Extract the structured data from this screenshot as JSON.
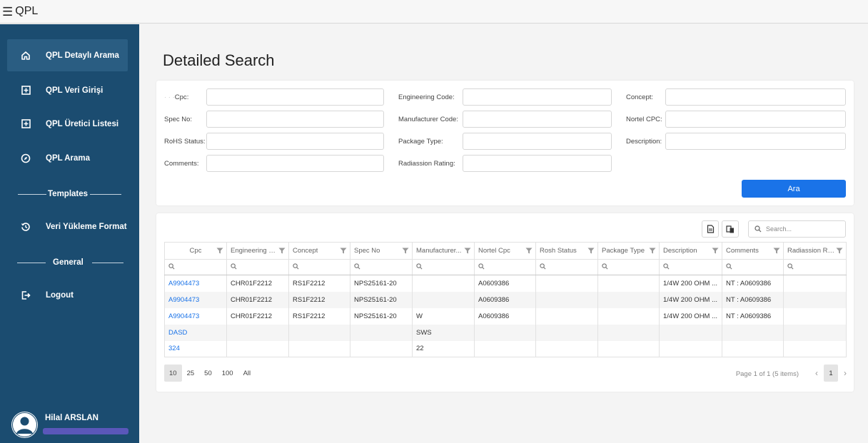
{
  "app": {
    "title": "QPL"
  },
  "sidebar": {
    "items": [
      {
        "label": "QPL Detaylı Arama",
        "icon": "home-icon"
      },
      {
        "label": "QPL Veri Girişi",
        "icon": "plus-square-icon"
      },
      {
        "label": "QPL Üretici Listesi",
        "icon": "plus-square-icon"
      },
      {
        "label": "QPL Arama",
        "icon": "compass-icon"
      }
    ],
    "section_templates": "Templates",
    "templates_item": {
      "label": "Veri Yükleme Format",
      "icon": "history-icon"
    },
    "section_general": "General",
    "logout": {
      "label": "Logout",
      "icon": "logout-icon"
    },
    "user": {
      "name": "Hilal ARSLAN"
    }
  },
  "page": {
    "title": "Detailed Search"
  },
  "form": {
    "fields": [
      {
        "label": "Cpc",
        "value": ""
      },
      {
        "label": "Spec No:",
        "value": ""
      },
      {
        "label": "RoHS Status:",
        "value": ""
      },
      {
        "label": "Comments:",
        "value": ""
      },
      {
        "label": "Engineering Code:",
        "value": ""
      },
      {
        "label": "Manufacturer Code:",
        "value": ""
      },
      {
        "label": "Package Type:",
        "value": ""
      },
      {
        "label": "Radiassion Rating:",
        "value": ""
      },
      {
        "label": "Concept:",
        "value": ""
      },
      {
        "label": "Nortel CPC:",
        "value": ""
      },
      {
        "label": "Description:",
        "value": ""
      }
    ],
    "search_button": "Ara"
  },
  "grid": {
    "search_placeholder": "Search...",
    "columns": [
      "Cpc",
      "Engineering Code",
      "Concept",
      "Spec No",
      "Manufacturer Code",
      "Nortel Cpc",
      "Rosh Status",
      "Package Type",
      "Description",
      "Comments",
      "Radiassion Rating"
    ],
    "column_display": [
      "Cpc",
      "Engineering C...",
      "Concept",
      "Spec No",
      "Manufacturer...",
      "Nortel Cpc",
      "Rosh Status",
      "Package Type",
      "Description",
      "Comments",
      "Radiassion Ra..."
    ],
    "rows": [
      [
        "A9904473",
        "CHR01F2212",
        "RS1F2212",
        "NPS25161-20",
        "",
        "A0609386",
        "",
        "",
        "1/4W 200 OHM ...",
        "NT : A0609386",
        ""
      ],
      [
        "A9904473",
        "CHR01F2212",
        "RS1F2212",
        "NPS25161-20",
        "",
        "A0609386",
        "",
        "",
        "1/4W 200 OHM ...",
        "NT : A0609386",
        ""
      ],
      [
        "A9904473",
        "CHR01F2212",
        "RS1F2212",
        "NPS25161-20",
        "W",
        "A0609386",
        "",
        "",
        "1/4W 200 OHM ...",
        "NT : A0609386",
        ""
      ],
      [
        "DASD",
        "",
        "",
        "",
        "SWS",
        "",
        "",
        "",
        "",
        "",
        ""
      ],
      [
        "324",
        "",
        "",
        "",
        "22",
        "",
        "",
        "",
        "",
        "",
        ""
      ]
    ],
    "page_sizes": [
      "10",
      "25",
      "50",
      "100",
      "All"
    ],
    "selected_page_size": "10",
    "page_info": "Page 1 of 1 (5 items)",
    "current_page": "1"
  }
}
